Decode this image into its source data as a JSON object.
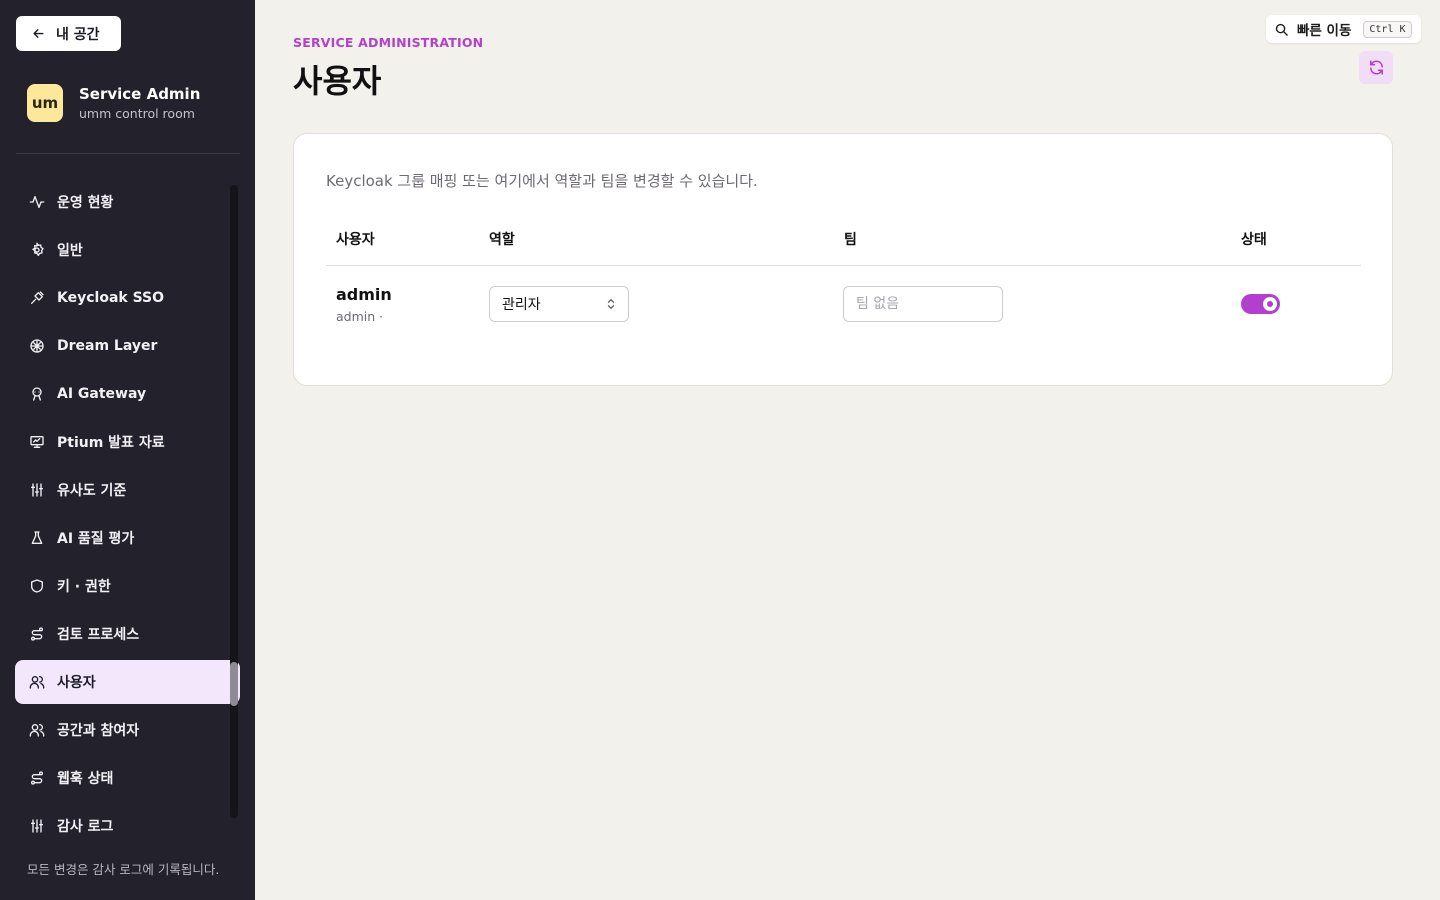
{
  "sidebar": {
    "back_label": "내 공간",
    "brand": {
      "logo": "um",
      "title": "Service Admin",
      "subtitle": "umm control room"
    },
    "items": [
      {
        "label": "운영 현황",
        "icon": "activity-icon"
      },
      {
        "label": "일반",
        "icon": "gear-icon"
      },
      {
        "label": "Keycloak SSO",
        "icon": "key-link-icon"
      },
      {
        "label": "Dream Layer",
        "icon": "brain-icon"
      },
      {
        "label": "AI Gateway",
        "icon": "bot-icon"
      },
      {
        "label": "Ptium 발표 자료",
        "icon": "presentation-icon"
      },
      {
        "label": "유사도 기준",
        "icon": "sliders-icon"
      },
      {
        "label": "AI 품질 평가",
        "icon": "flask-icon"
      },
      {
        "label": "키 · 권한",
        "icon": "shield-icon"
      },
      {
        "label": "검토 프로세스",
        "icon": "route-icon"
      },
      {
        "label": "사용자",
        "icon": "users-icon",
        "active": true
      },
      {
        "label": "공간과 참여자",
        "icon": "users-icon"
      },
      {
        "label": "웹훅 상태",
        "icon": "route-icon"
      },
      {
        "label": "감사 로그",
        "icon": "sliders-icon"
      }
    ],
    "footer": "모든 변경은 감사 로그에 기록됩니다."
  },
  "header": {
    "eyebrow": "SERVICE ADMINISTRATION",
    "title": "사용자",
    "quick_nav": {
      "label": "빠른 이동",
      "shortcut": "Ctrl K"
    }
  },
  "card": {
    "description": "Keycloak 그룹 매핑 또는 여기에서 역할과 팀을 변경할 수 있습니다.",
    "columns": [
      "사용자",
      "역할",
      "팀",
      "상태"
    ],
    "rows": [
      {
        "name": "admin",
        "sub": "admin ·",
        "role": "관리자",
        "team_placeholder": "팀 없음",
        "team_value": "",
        "active": true
      }
    ]
  },
  "colors": {
    "accent": "#b23fd0",
    "sidebar_bg": "#23212b",
    "page_bg": "#f3f1ec",
    "active_item_bg": "#f3e8fb"
  }
}
